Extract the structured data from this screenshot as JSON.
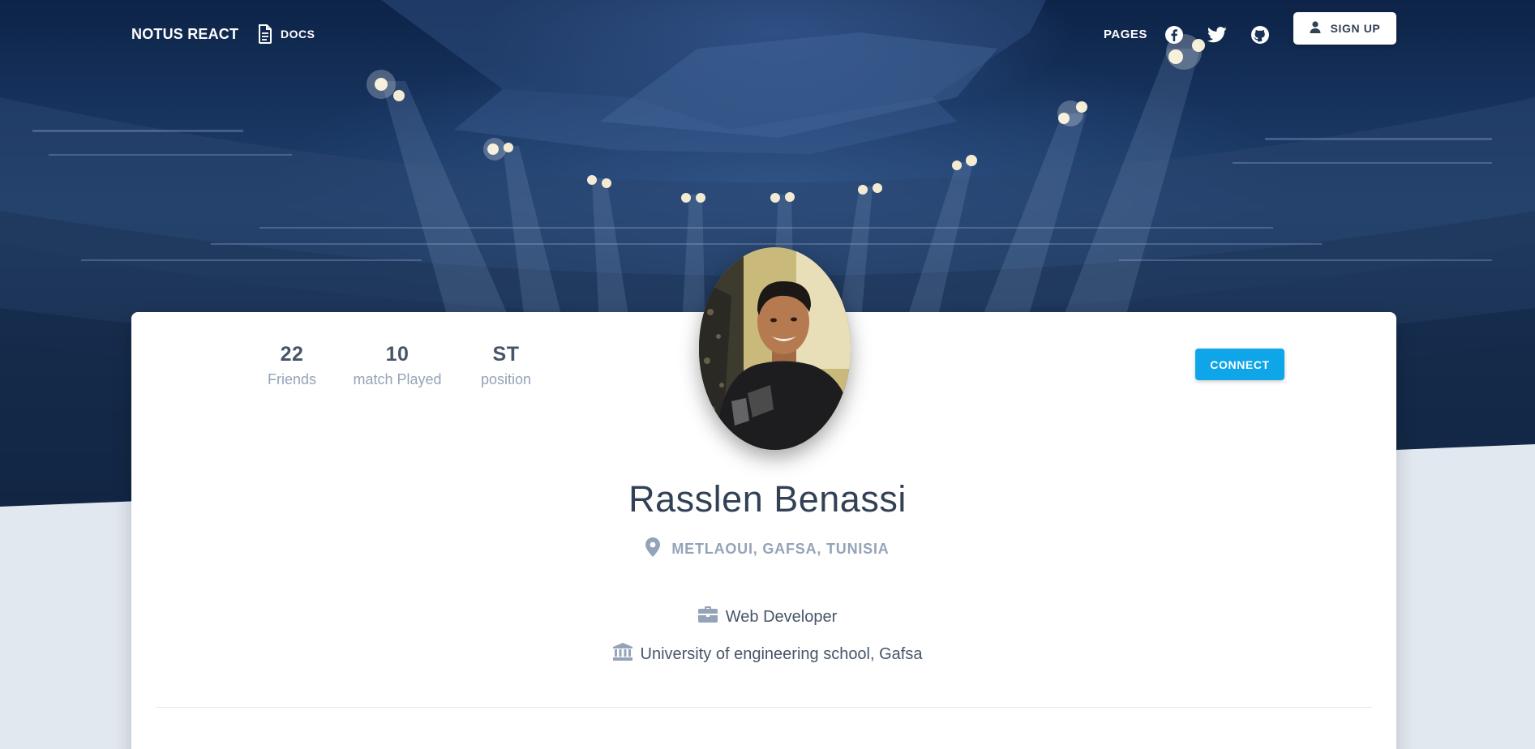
{
  "navbar": {
    "brand": "NOTUS REACT",
    "docs_label": "DOCS",
    "pages_label": "PAGES",
    "social_icons": [
      "facebook-icon",
      "twitter-icon",
      "github-icon"
    ],
    "signup_label": "SIGN UP"
  },
  "profile": {
    "stats": [
      {
        "value": "22",
        "label": "Friends"
      },
      {
        "value": "10",
        "label": "match Played"
      },
      {
        "value": "ST",
        "label": "position"
      }
    ],
    "connect_label": "CONNECT",
    "name": "Rasslen Benassi",
    "location": "METLAOUI, GAFSA, TUNISIA",
    "job": "Web Developer",
    "education": "University of engineering school, Gafsa"
  },
  "colors": {
    "accent": "#0ea5e9",
    "page_bg": "#e2e8f0",
    "card_bg": "#ffffff",
    "text_dark": "#334155",
    "text_muted": "#94a3b8"
  }
}
